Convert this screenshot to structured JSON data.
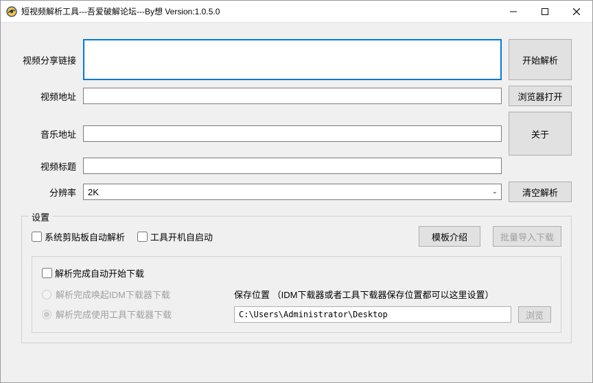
{
  "window": {
    "title": "短视频解析工具---吾爱破解论坛---By想  Version:1.0.5.0"
  },
  "form": {
    "share_label": "视频分享链接",
    "share_value": "",
    "video_url_label": "视频地址",
    "video_url_value": "",
    "music_url_label": "音乐地址",
    "music_url_value": "",
    "title_label": "视频标题",
    "title_value": "",
    "resolution_label": "分辨率",
    "resolution_value": "2K"
  },
  "buttons": {
    "parse": "开始解析",
    "open_browser": "浏览器打开",
    "about": "关于",
    "clear": "清空解析",
    "template_intro": "模板介绍",
    "batch_import": "批量导入下载",
    "browse": "浏览"
  },
  "settings": {
    "legend": "设置",
    "chk_clipboard": "系统剪贴板自动解析",
    "chk_autostart": "工具开机自启动",
    "chk_auto_download": "解析完成自动开始下载",
    "radio_idm": "解析完成唤起IDM下载器下载",
    "radio_tool": "解析完成使用工具下载器下载",
    "save_label": "保存位置 （IDM下载器或者工具下载器保存位置都可以这里设置）",
    "save_path": "C:\\Users\\Administrator\\Desktop"
  }
}
